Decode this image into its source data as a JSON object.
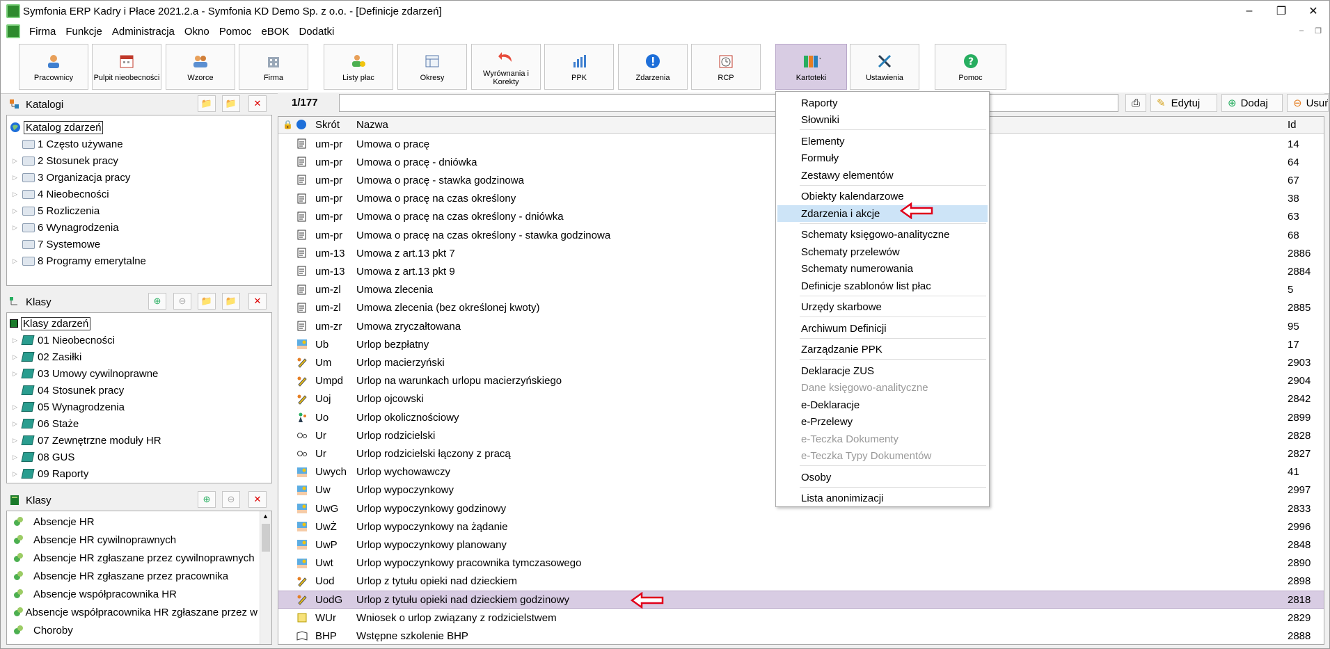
{
  "window": {
    "title": "Symfonia ERP Kadry i Płace 2021.2.a - Symfonia KD Demo Sp. z o.o. - [Definicje zdarzeń]"
  },
  "menu": [
    "Firma",
    "Funkcje",
    "Administracja",
    "Okno",
    "Pomoc",
    "eBOK",
    "Dodatki"
  ],
  "toolbar": {
    "buttons": [
      {
        "label": "Pracownicy",
        "icon": "person-icon"
      },
      {
        "label": "Pulpit nieobecności",
        "icon": "calendar-icon"
      },
      {
        "label": "Wzorce",
        "icon": "people-icon"
      },
      {
        "label": "Firma",
        "icon": "building-icon"
      },
      {
        "label": "Listy płac",
        "icon": "payroll-icon"
      },
      {
        "label": "Okresy",
        "icon": "periods-icon"
      },
      {
        "label": "Wyrównania i Korekty",
        "icon": "return-arrow-icon"
      },
      {
        "label": "PPK",
        "icon": "bar-chart-icon"
      },
      {
        "label": "Zdarzenia",
        "icon": "info-icon"
      },
      {
        "label": "RCP",
        "icon": "clock-icon"
      },
      {
        "label": "Kartoteki",
        "icon": "binders-icon"
      },
      {
        "label": "Ustawienia",
        "icon": "tools-icon"
      },
      {
        "label": "Pomoc",
        "icon": "help-icon"
      }
    ]
  },
  "katalogi": {
    "title": "Katalogi",
    "root": "Katalog zdarzeń",
    "items": [
      "1 Często używane",
      "2 Stosunek pracy",
      "3 Organizacja pracy",
      "4 Nieobecności",
      "5 Rozliczenia",
      "6 Wynagrodzenia",
      "7 Systemowe",
      "8 Programy emerytalne"
    ]
  },
  "klasy1": {
    "title": "Klasy",
    "root": "Klasy zdarzeń",
    "items": [
      "01 Nieobecności",
      "02 Zasiłki",
      "03 Umowy cywilnoprawne",
      "04 Stosunek pracy",
      "05 Wynagrodzenia",
      "06 Staże",
      "07 Zewnętrzne moduły HR",
      "08 GUS",
      "09 Raporty"
    ]
  },
  "klasy2": {
    "title": "Klasy",
    "items": [
      "Absencje HR",
      "Absencje HR cywilnoprawnych",
      "Absencje HR zgłaszane przez cywilnoprawnych",
      "Absencje HR zgłaszane przez pracownika",
      "Absencje współpracownika HR",
      "Absencje współpracownika HR zgłaszane przez w",
      "Choroby"
    ]
  },
  "grid": {
    "counter": "1/177",
    "headers": {
      "abbr": "Skrót",
      "name": "Nazwa",
      "id": "Id"
    },
    "actions": {
      "edit": "Edytuj",
      "add": "Dodaj",
      "remove": "Usuń"
    },
    "rows": [
      {
        "abbr": "um-pr",
        "name": "Umowa o pracę",
        "id": "14"
      },
      {
        "abbr": "um-pr",
        "name": "Umowa o pracę - dniówka",
        "id": "64"
      },
      {
        "abbr": "um-pr",
        "name": "Umowa o pracę - stawka godzinowa",
        "id": "67"
      },
      {
        "abbr": "um-pr",
        "name": "Umowa o pracę na czas określony",
        "id": "38"
      },
      {
        "abbr": "um-pr",
        "name": "Umowa o pracę na czas określony - dniówka",
        "id": "63"
      },
      {
        "abbr": "um-pr",
        "name": "Umowa o pracę na czas określony - stawka godzinowa",
        "id": "68"
      },
      {
        "abbr": "um-13",
        "name": "Umowa z art.13 pkt 7",
        "id": "2886"
      },
      {
        "abbr": "um-13",
        "name": "Umowa z art.13 pkt 9",
        "id": "2884"
      },
      {
        "abbr": "um-zl",
        "name": "Umowa zlecenia",
        "id": "5"
      },
      {
        "abbr": "um-zl",
        "name": "Umowa zlecenia (bez określonej kwoty)",
        "id": "2885"
      },
      {
        "abbr": "um-zr",
        "name": "Umowa zryczałtowana",
        "id": "95"
      },
      {
        "abbr": "Ub",
        "name": "Urlop bezpłatny",
        "id": "17"
      },
      {
        "abbr": "Um",
        "name": "Urlop macierzyński",
        "id": "2903"
      },
      {
        "abbr": "Umpd",
        "name": "Urlop na warunkach urlopu macierzyńskiego",
        "id": "2904"
      },
      {
        "abbr": "Uoj",
        "name": "Urlop ojcowski",
        "id": "2842"
      },
      {
        "abbr": "Uo",
        "name": "Urlop okolicznościowy",
        "id": "2899"
      },
      {
        "abbr": "Ur",
        "name": "Urlop rodzicielski",
        "id": "2828"
      },
      {
        "abbr": "Ur",
        "name": "Urlop rodzicielski łączony z pracą",
        "id": "2827"
      },
      {
        "abbr": "Uwych",
        "name": "Urlop wychowawczy",
        "id": "41"
      },
      {
        "abbr": "Uw",
        "name": "Urlop wypoczynkowy",
        "id": "2997"
      },
      {
        "abbr": "UwG",
        "name": "Urlop wypoczynkowy godzinowy",
        "id": "2833"
      },
      {
        "abbr": "UwŻ",
        "name": "Urlop wypoczynkowy na żądanie",
        "id": "2996"
      },
      {
        "abbr": "UwP",
        "name": "Urlop wypoczynkowy planowany",
        "id": "2848"
      },
      {
        "abbr": "Uwt",
        "name": "Urlop wypoczynkowy pracownika tymczasowego",
        "id": "2890"
      },
      {
        "abbr": "Uod",
        "name": "Urlop z tytułu opieki nad dzieckiem",
        "id": "2898"
      },
      {
        "abbr": "UodG",
        "name": "Urlop z tytułu opieki nad dzieckiem godzinowy",
        "id": "2818"
      },
      {
        "abbr": "WUr",
        "name": "Wniosek o urlop związany z rodzicielstwem",
        "id": "2829"
      },
      {
        "abbr": "BHP",
        "name": "Wstępne szkolenie BHP",
        "id": "2888"
      }
    ]
  },
  "kartoteki_menu": {
    "groups": [
      [
        {
          "label": "Raporty"
        },
        {
          "label": "Słowniki"
        }
      ],
      [
        {
          "label": "Elementy"
        },
        {
          "label": "Formuły"
        },
        {
          "label": "Zestawy elementów"
        }
      ],
      [
        {
          "label": "Obiekty kalendarzowe"
        },
        {
          "label": "Zdarzenia i akcje",
          "highlighted": true
        }
      ],
      [
        {
          "label": "Schematy księgowo-analityczne"
        },
        {
          "label": "Schematy przelewów"
        },
        {
          "label": "Schematy numerowania"
        },
        {
          "label": "Definicje szablonów list płac"
        }
      ],
      [
        {
          "label": "Urzędy skarbowe"
        }
      ],
      [
        {
          "label": "Archiwum Definicji"
        }
      ],
      [
        {
          "label": "Zarządzanie PPK"
        }
      ],
      [
        {
          "label": "Deklaracje ZUS"
        },
        {
          "label": "Dane księgowo-analityczne",
          "disabled": true
        },
        {
          "label": "e-Deklaracje"
        },
        {
          "label": "e-Przelewy"
        },
        {
          "label": "e-Teczka Dokumenty",
          "disabled": true
        },
        {
          "label": "e-Teczka Typy Dokumentów",
          "disabled": true
        }
      ],
      [
        {
          "label": "Osoby"
        }
      ],
      [
        {
          "label": "Lista anonimizacji"
        }
      ]
    ]
  },
  "colors": {
    "selection": "#d8cce3",
    "highlight": "#cde4f7",
    "arrow": "#e0001a"
  }
}
